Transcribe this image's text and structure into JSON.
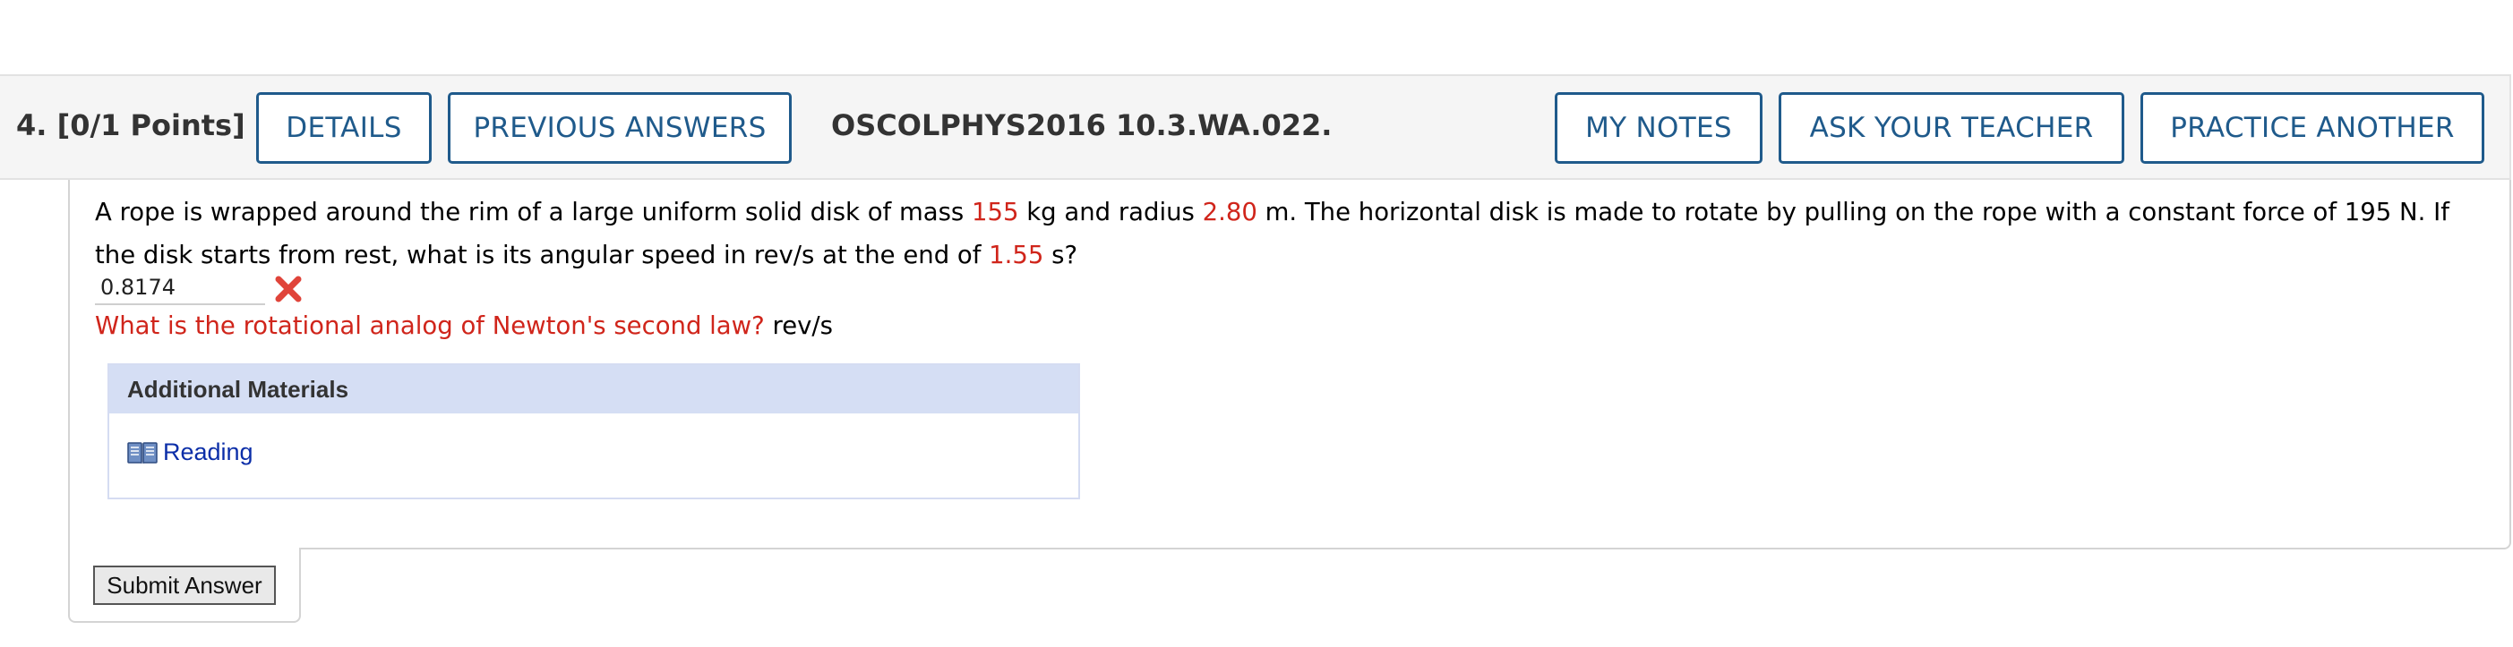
{
  "header": {
    "question_number": "4.",
    "points": "[0/1 Points]",
    "details_button": "DETAILS",
    "previous_answers_button": "PREVIOUS ANSWERS",
    "assignment_code": "OSCOLPHYS2016 10.3.WA.022.",
    "my_notes_button": "MY NOTES",
    "ask_teacher_button": "ASK YOUR TEACHER",
    "practice_another_button": "PRACTICE ANOTHER",
    "button_color": "#1f5a8b"
  },
  "question": {
    "text_1": "A rope is wrapped around the rim of a large uniform solid disk of mass ",
    "mass_value": "155",
    "text_2": " kg and radius ",
    "radius_value": "2.80",
    "text_3": " m. The horizontal disk is made to rotate by pulling on the rope with a constant force of 195 N. If the disk starts from rest, what is its angular speed in rev/s at the end of ",
    "time_value": "1.55",
    "text_4": " s?",
    "highlight_color": "#d0251b"
  },
  "answer": {
    "value": "0.8174",
    "status_icon": "incorrect-x-icon",
    "hint": "What is the rotational analog of Newton's second law?",
    "unit": "rev/s"
  },
  "materials": {
    "title": "Additional Materials",
    "items": [
      {
        "label": "Reading",
        "icon": "book-icon"
      }
    ]
  },
  "submit": {
    "label": "Submit Answer"
  }
}
